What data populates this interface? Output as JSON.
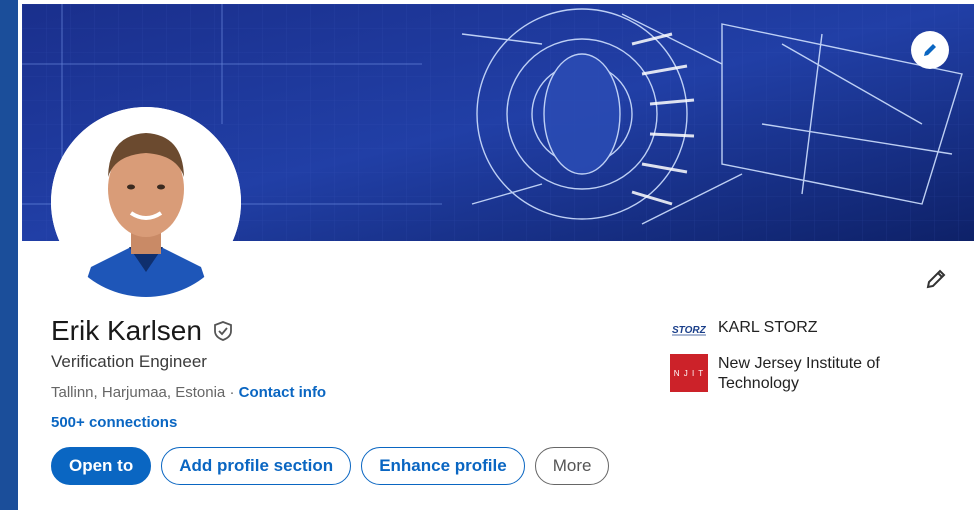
{
  "profile": {
    "name": "Erik Karlsen",
    "headline": "Verification Engineer",
    "location": "Tallinn, Harjumaa, Estonia",
    "separator": "·",
    "contact_info_label": "Contact info",
    "connections_label": "500+ connections"
  },
  "actions": {
    "open_to": "Open to",
    "add_profile_section": "Add profile section",
    "enhance_profile": "Enhance profile",
    "more": "More"
  },
  "experience": [
    {
      "name": "KARL STORZ",
      "logo_text": "STORZ"
    },
    {
      "name": "New Jersey Institute of Technology",
      "logo_text": "NJIT"
    }
  ],
  "colors": {
    "accent": "#0a66c2",
    "banner": "#1d3a9e",
    "njit_red": "#cc2229"
  },
  "icons": {
    "banner_edit": "pencil-icon",
    "intro_edit": "pencil-icon",
    "verified": "shield-check-icon"
  }
}
